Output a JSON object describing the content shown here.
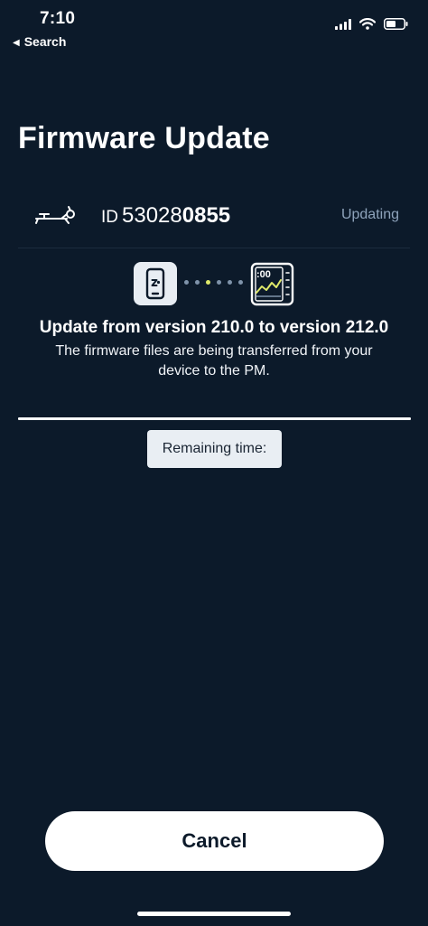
{
  "status_bar": {
    "time": "7:10",
    "back_label": "Search",
    "icons": [
      "signal-icon",
      "wifi-icon",
      "battery-icon"
    ]
  },
  "header": {
    "title": "Firmware Update"
  },
  "device": {
    "icon": "rowing-machine-icon",
    "id_prefix": "ID",
    "id_regular": "53028",
    "id_bold": "0855",
    "status": "Updating"
  },
  "transfer": {
    "source_icon": "phone-icon",
    "target_icon": "monitor-icon",
    "monitor_screen_text": ":00",
    "dot_count": 6,
    "active_dot_index": 2
  },
  "update": {
    "title": "Update from version 210.0 to version 212.0",
    "description": "The firmware files are being transferred from your device to the PM."
  },
  "progress": {
    "percent": 100
  },
  "remaining": {
    "label": "Remaining time:"
  },
  "actions": {
    "cancel_label": "Cancel"
  },
  "colors": {
    "background": "#0c1a2a",
    "text": "#ffffff",
    "muted": "#8ea3bb",
    "accent": "#dfe96a",
    "chip": "#e9eef3"
  }
}
